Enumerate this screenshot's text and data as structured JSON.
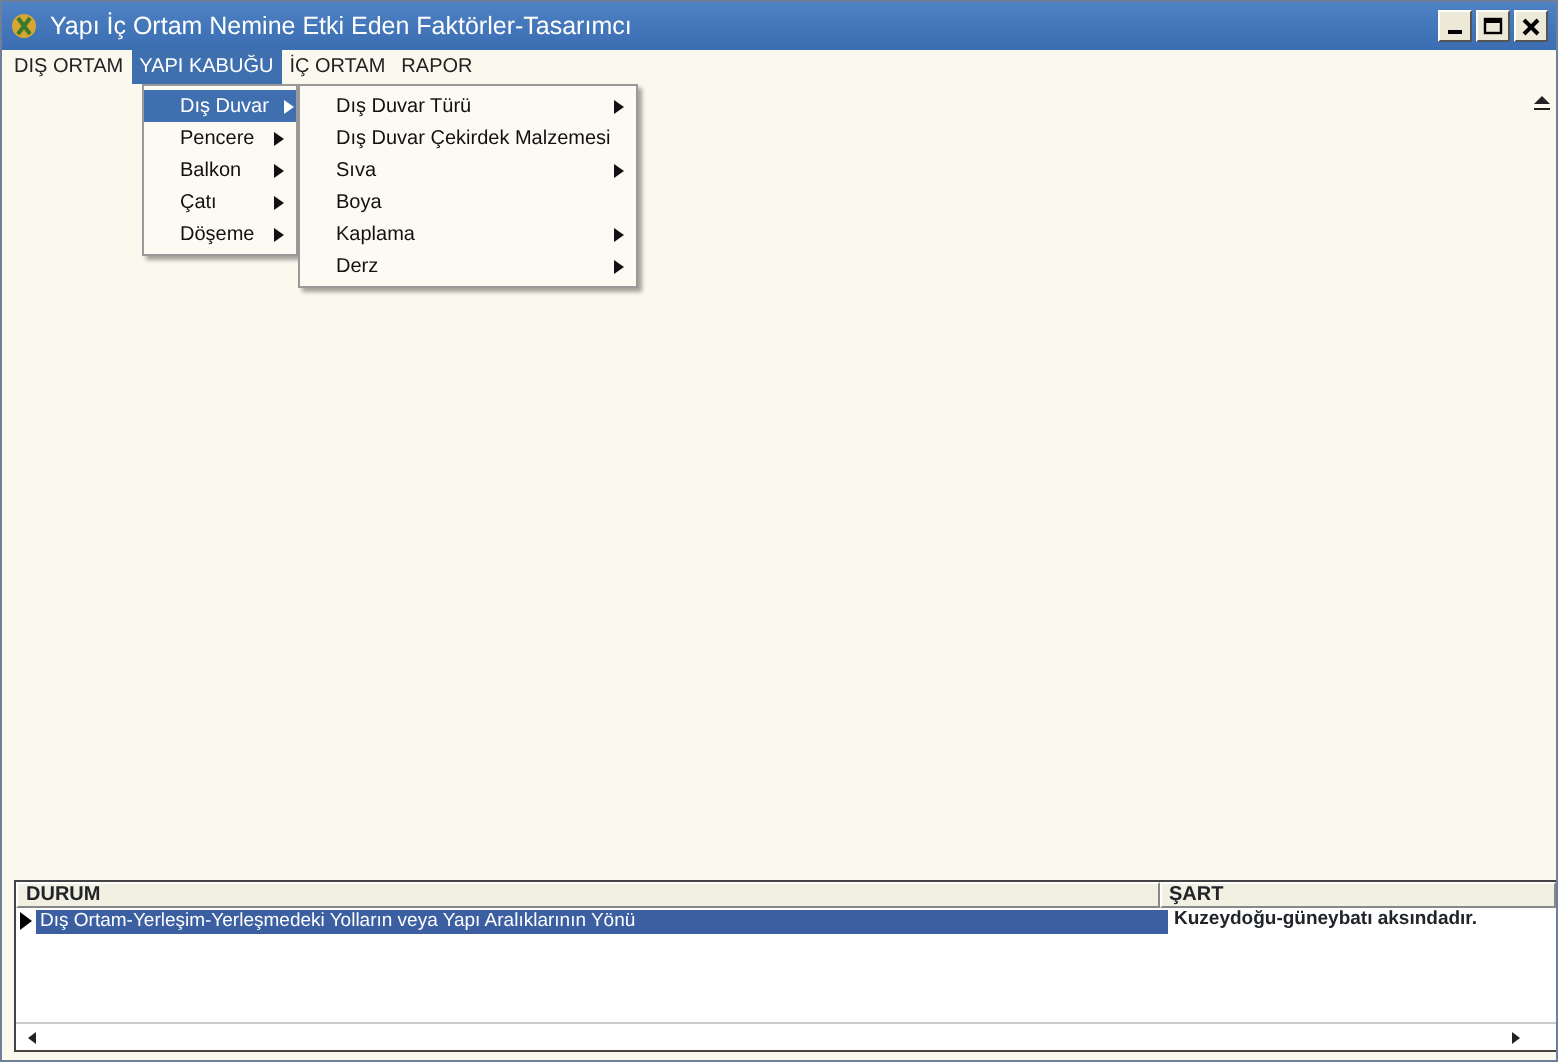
{
  "window": {
    "title": "Yapı İç Ortam Nemine  Etki Eden Faktörler-Tasarımcı"
  },
  "menu_bar": [
    {
      "label": "DIŞ ORTAM",
      "selected": false
    },
    {
      "label": "YAPI KABUĞU",
      "selected": true
    },
    {
      "label": "İÇ ORTAM",
      "selected": false
    },
    {
      "label": "RAPOR",
      "selected": false
    }
  ],
  "menu": [
    {
      "label": "Dış Duvar",
      "submenu": true,
      "selected": true
    },
    {
      "label": "Pencere",
      "submenu": true,
      "selected": false
    },
    {
      "label": "Balkon",
      "submenu": true,
      "selected": false
    },
    {
      "label": "Çatı",
      "submenu": true,
      "selected": false
    },
    {
      "label": "Döşeme",
      "submenu": true,
      "selected": false
    }
  ],
  "submenu": [
    {
      "label": "Dış Duvar Türü",
      "submenu": true,
      "selected": false
    },
    {
      "label": "Dış Duvar Çekirdek Malzemesi",
      "submenu": false,
      "selected": false
    },
    {
      "label": "Sıva",
      "submenu": true,
      "selected": false
    },
    {
      "label": "Boya",
      "submenu": false,
      "selected": false
    },
    {
      "label": "Kaplama",
      "submenu": true,
      "selected": false
    },
    {
      "label": "Derz",
      "submenu": true,
      "selected": false
    }
  ],
  "table": {
    "columns": [
      "DURUM",
      "ŞART"
    ],
    "rows": [
      {
        "cells": [
          "Dış Ortam-Yerleşim-Yerleşmedeki  Yolların veya Yapı Aralıklarının Yönü",
          "Kuzeydoğu-güneybatı aksındadır."
        ],
        "selected": true
      }
    ]
  }
}
